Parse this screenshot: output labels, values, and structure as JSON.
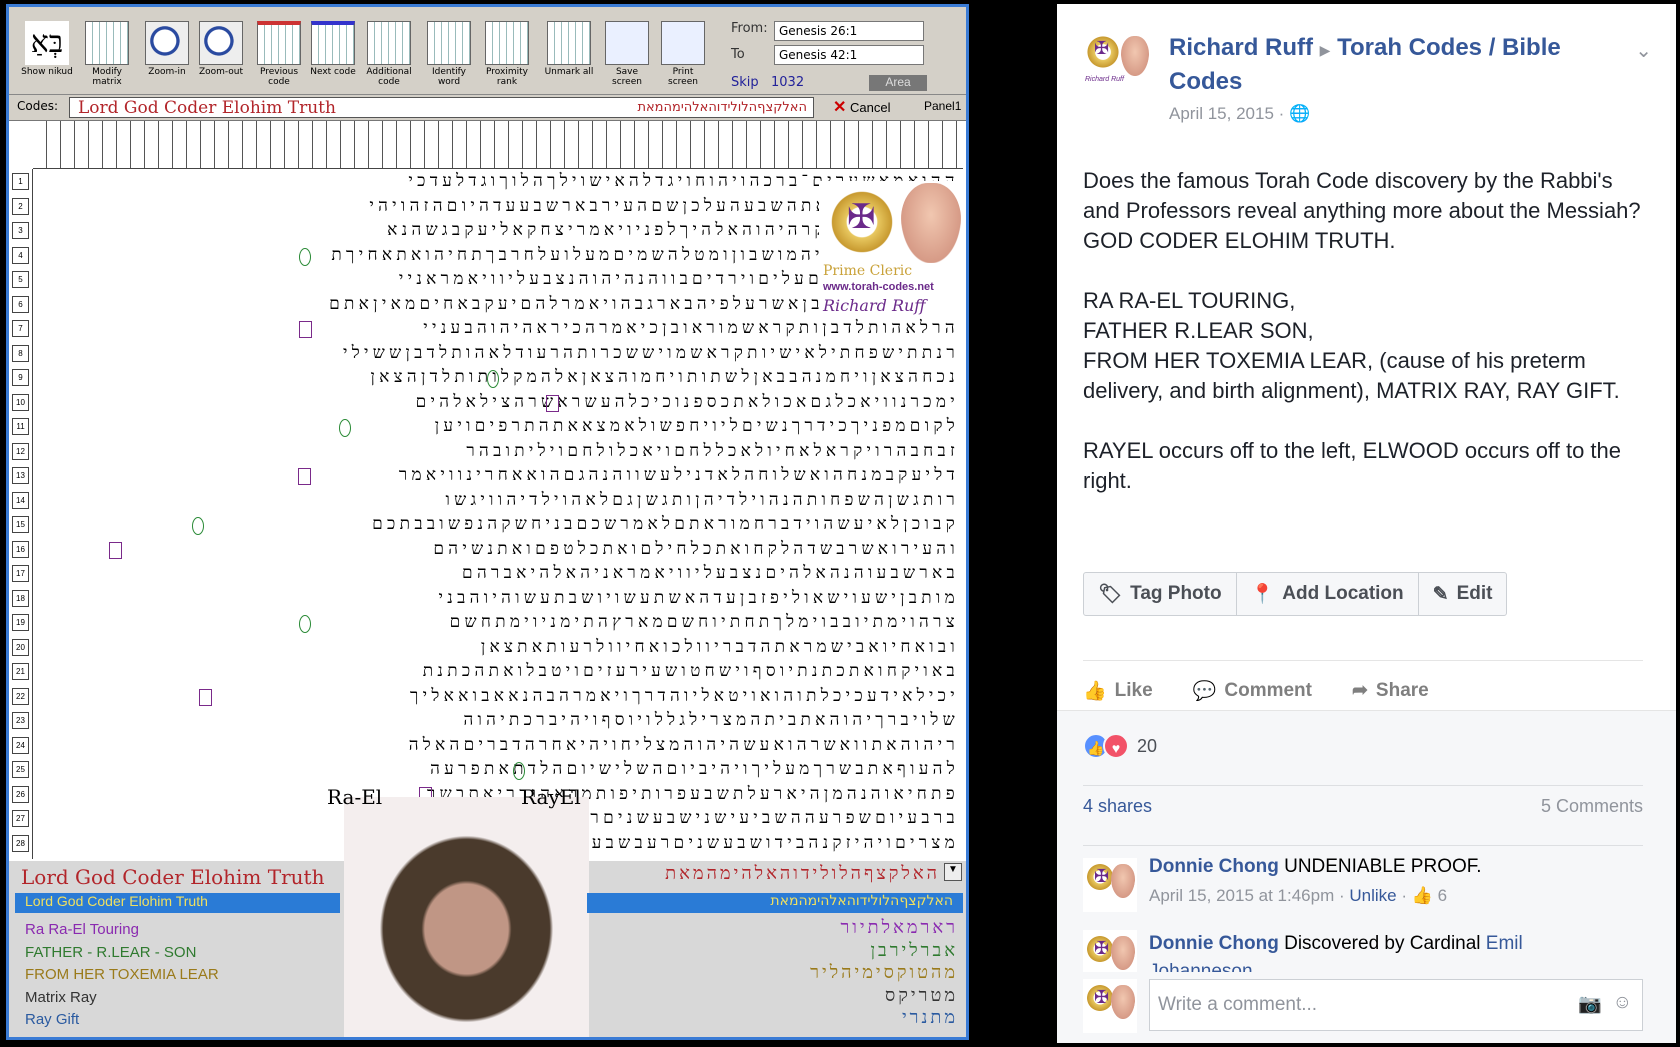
{
  "app": {
    "toolbar": [
      {
        "label": "Show nikud",
        "icon": "hebrew-letter-icon"
      },
      {
        "label": "Modify matrix",
        "icon": "matrix-icon"
      },
      {
        "label": "Zoom-in",
        "icon": "zoom-in-icon"
      },
      {
        "label": "Zoom-out",
        "icon": "zoom-out-icon"
      },
      {
        "label": "Previous code",
        "icon": "previous-code-icon"
      },
      {
        "label": "Next code",
        "icon": "next-code-icon"
      },
      {
        "label": "Additional code",
        "icon": "additional-code-icon"
      },
      {
        "label": "Identify word",
        "icon": "identify-word-icon"
      },
      {
        "label": "Proximity rank",
        "icon": "proximity-rank-icon"
      },
      {
        "label": "Unmark all",
        "icon": "unmark-icon"
      },
      {
        "label": "Save screen",
        "icon": "save-icon"
      },
      {
        "label": "Print screen",
        "icon": "print-icon"
      }
    ],
    "hebrew_glyph": "בְּאַ",
    "range": {
      "from_label": "From:",
      "from_value": "Genesis 26:1",
      "to_label": "To",
      "to_value": "Genesis 42:1",
      "skip_label": "Skip",
      "skip_value": "1032",
      "area_label": "Area"
    },
    "codes": {
      "label": "Codes:",
      "value": "Lord God Coder Elohim Truth",
      "hebrew": "האלקצףהלולידוהאלהימהמאת",
      "cancel": "Cancel",
      "panel": "Panel1"
    },
    "rows": [
      "ההואמאשערים־ברכהויהוחויגדלהאישוילךהלוךוגדלעדכי",
      "צאנוםוניקראאתהשבעהעלכןשםהעירבארשבעעדהיוםהזהויהי",
      "אבניואמרכיהקרהיהוהאלהיךלפניויאמריצחקאליעקבגשהנא",
      "שמניהארץויהיהמושבוןומטלהשמיםמעלועלחרבךתחיהואתאחיךת",
      "נהמלאכיאלהיםעליםוירדיםבווהנהיהוהנצבעליוויאמראניי",
      "אהעםוהאעלאבןאשרעלפיהבארגבהויאמרלהםיעקבאחיםמאיןאתם",
      "הרלאהותלדבןותקראשמוראובןכיאמרהכיראהיהוהבעניי",
      "רנתתישפחתילאישיותקראשמויששכרותהרעודלאהותלדבןששילי",
      "נכחהצאןויחמנהבבאןלשתותויחמוהצאןאלהמקלותותלדןהצאן",
      "ימכרנוויאכלגםאכולאתכספנוכיכלהעשראשרהצילאלהים",
      "לקוםמפניךכידרךנשיםליויחפשולאמצאאתהתרפיםויען",
      "זבחבהרויקראלאחיולאכללחםויאכלולחםויליתובהר",
      "דליעקבמנחהואשלוחהלאדנילעשווהנהגםהואאחרינוויאמר",
      "רותגשןהשפחותהנהוילדיהןותגשןגםלאהוילדיהוויגשו",
      "קבוכןלאיעשהוידברחמוראתםלאמרשכםבניחשקהנפשובבתכם",
      "והעירואשרבשדהלקחואתכלחילםואתכלטפםואתנשיהם",
      "בארשבעוהנהאלהיםנצבעליוויאמראניהאלהיאברהם",
      "מותבןישעוישאוליפזבןעדהאשתעשויושבתעשוהיוהבני",
      "צרהוימתיובבוימלךתחתיוחשםמארץהתימניוימתחשם",
      "ובואחיואבישמראתהדבריוולכואחיוולרעותאתצאן",
      "באויקחואתכתנתיוסףוישחטושעירעזיםויטבלואתהכתנת",
      "יכילאידעכיכלתוהואויטאליוהדרךויאמרהבהנאאבואאליך",
      "שלויברךיהוהאתביתהמצרילגללויוסףויהיברכתיהוה",
      "ריהוהאתוואשרהואעשהיהוהמצליחויהיאחרהדבריםהאלה",
      "להעוףאתבשרךמעליךויהיביוםהשלישיוםהלדתאתפרעה",
      "פתחיאוהנהמןהיארעלתשבעפרותיפותמראהובריאתבשר",
      "ברבעיוםשפרעההשביעישנישבעשניםרעבשבעשנים",
      "מצריםויהיזקנהבידושבעשניםרעבשבעשניםוישבאתהלשבר"
    ],
    "promo": {
      "prime": "Prime Cleric",
      "url": "www.torah-codes.net",
      "signature": "Richard Ruff"
    },
    "labels": {
      "ra_el": "Ra-El",
      "rayel": "RayEl"
    },
    "results": {
      "title": "Lord God Coder Elohim Truth",
      "selected": "Lord God Coder Elohim Truth",
      "selected_hebrew": "האלקצףהלולידוהאלהימהמאת",
      "items": [
        {
          "text": "Ra Ra-El Touring",
          "color": "#8a2ab0"
        },
        {
          "text": "FATHER - R.LEAR - SON",
          "color": "#2f7a2f"
        },
        {
          "text": "FROM HER TOXEMIA LEAR",
          "color": "#9a7a1a"
        },
        {
          "text": "Matrix Ray",
          "color": "#333333"
        },
        {
          "text": "Ray Gift",
          "color": "#2a5aa0"
        }
      ],
      "hebrew_items": [
        "רארמאלתיור",
        "אברלירבן",
        "מהטוקסימיהליר",
        "מטריקס",
        "מתנרי"
      ]
    }
  },
  "post": {
    "author": "Richard Ruff",
    "group": "Torah Codes / Bible Codes",
    "date": "April 15, 2015",
    "body": "Does the famous Torah Code discovery by the Rabbi's and Professors reveal anything more about the Messiah? GOD CODER ELOHIM TRUTH.\n\nRA RA-EL TOURING,\nFATHER R.LEAR SON,\nFROM HER TOXEMIA LEAR, (cause of his preterm delivery, and birth alignment), MATRIX RAY, RAY GIFT.\n\nRAYEL occurs off to the left, ELWOOD occurs off to the right.",
    "actions": {
      "tag_photo": "Tag Photo",
      "add_location": "Add Location",
      "edit": "Edit"
    },
    "social": {
      "like": "Like",
      "comment": "Comment",
      "share": "Share"
    },
    "reactions_count": "20",
    "shares": "4 shares",
    "comments_count": "5 Comments",
    "comments": [
      {
        "name": "Donnie Chong",
        "text": "UNDENIABLE PROOF.",
        "time": "April 15, 2015 at 1:46pm",
        "unlike": "Unlike",
        "likes": "6"
      },
      {
        "name": "Donnie Chong",
        "text": "Discovered by Cardinal ",
        "link": "Emil Johanneson"
      }
    ],
    "write_placeholder": "Write a comment..."
  },
  "colors": {
    "fb_link": "#365899",
    "selection": "#2a7bd6",
    "code_red": "#b2252a"
  }
}
